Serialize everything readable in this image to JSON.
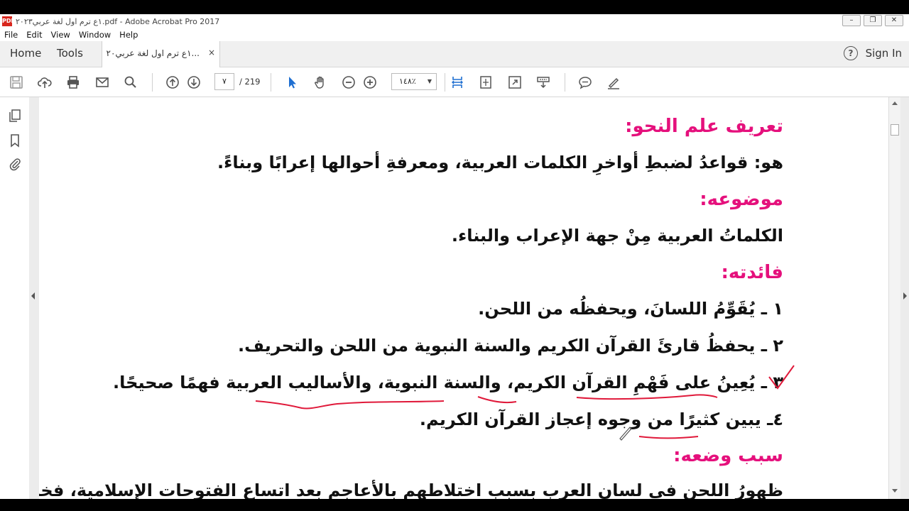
{
  "window": {
    "title": "١ع ترم اول لغة عربي٢٠٢٣.pdf - Adobe Acrobat Pro 2017"
  },
  "menu": [
    "File",
    "Edit",
    "View",
    "Window",
    "Help"
  ],
  "tabs": {
    "home": "Home",
    "tools": "Tools",
    "document": "١ع ترم اول لغة عربي٢٠...",
    "close": "×",
    "help": "?",
    "signin": "Sign In"
  },
  "toolbar": {
    "page_current": "٧",
    "page_total": "/ 219",
    "zoom": "١٤٨٪",
    "zoom_arrow": "▼"
  },
  "content": {
    "lines": [
      {
        "text": "تعريف علم النحو:",
        "kind": "heading"
      },
      {
        "text": "هو: قواعدُ لضبطِ أواخرِ الكلمات العربية، ومعرفةِ أحوالها إعرابًا وبناءً.",
        "kind": "body"
      },
      {
        "text": "موضوعه:",
        "kind": "heading"
      },
      {
        "text": "الكلماتُ العربية مِنْ جهة الإعراب والبناء.",
        "kind": "body"
      },
      {
        "text": "فائدته:",
        "kind": "heading"
      },
      {
        "text": "١ ـ يُقَوِّمُ اللسانَ، ويحفظُه من اللحن.",
        "kind": "body"
      },
      {
        "text": "٢ ـ يحفظُ قارئَ القرآن الكريم والسنة النبوية من اللحن والتحريف.",
        "kind": "body"
      },
      {
        "text": "٣ ـ يُعِينُ على فَهْمِ القرآن الكريم، والسنة النبوية، والأساليب العربية فهمًا صحيحًا.",
        "kind": "body"
      },
      {
        "text": "٤ـ يبين كثيرًا من وجوه إعجاز القرآن الكريم.",
        "kind": "body"
      },
      {
        "text": "سبب وضعه:",
        "kind": "heading"
      },
      {
        "text": "ظهورُ اللحن في لسان العرب بسبب اختلاطهم بالأعاجم بعد اتساع الفتوحات الإسلامية، فخاف الولاةُ",
        "kind": "body"
      }
    ]
  },
  "colors": {
    "heading": "#e5107c",
    "annotation": "#e0193a"
  },
  "icons": [
    "save-icon",
    "upload-icon",
    "print-icon",
    "mail-icon",
    "search-icon",
    "page-up-icon",
    "page-down-icon",
    "select-cursor-icon",
    "hand-icon",
    "zoom-out-icon",
    "zoom-in-icon",
    "fit-width-icon",
    "fit-page-icon",
    "fullscreen-icon",
    "read-mode-icon",
    "comment-icon",
    "highlight-pen-icon",
    "pages-icon",
    "bookmark-icon",
    "attachment-icon"
  ]
}
